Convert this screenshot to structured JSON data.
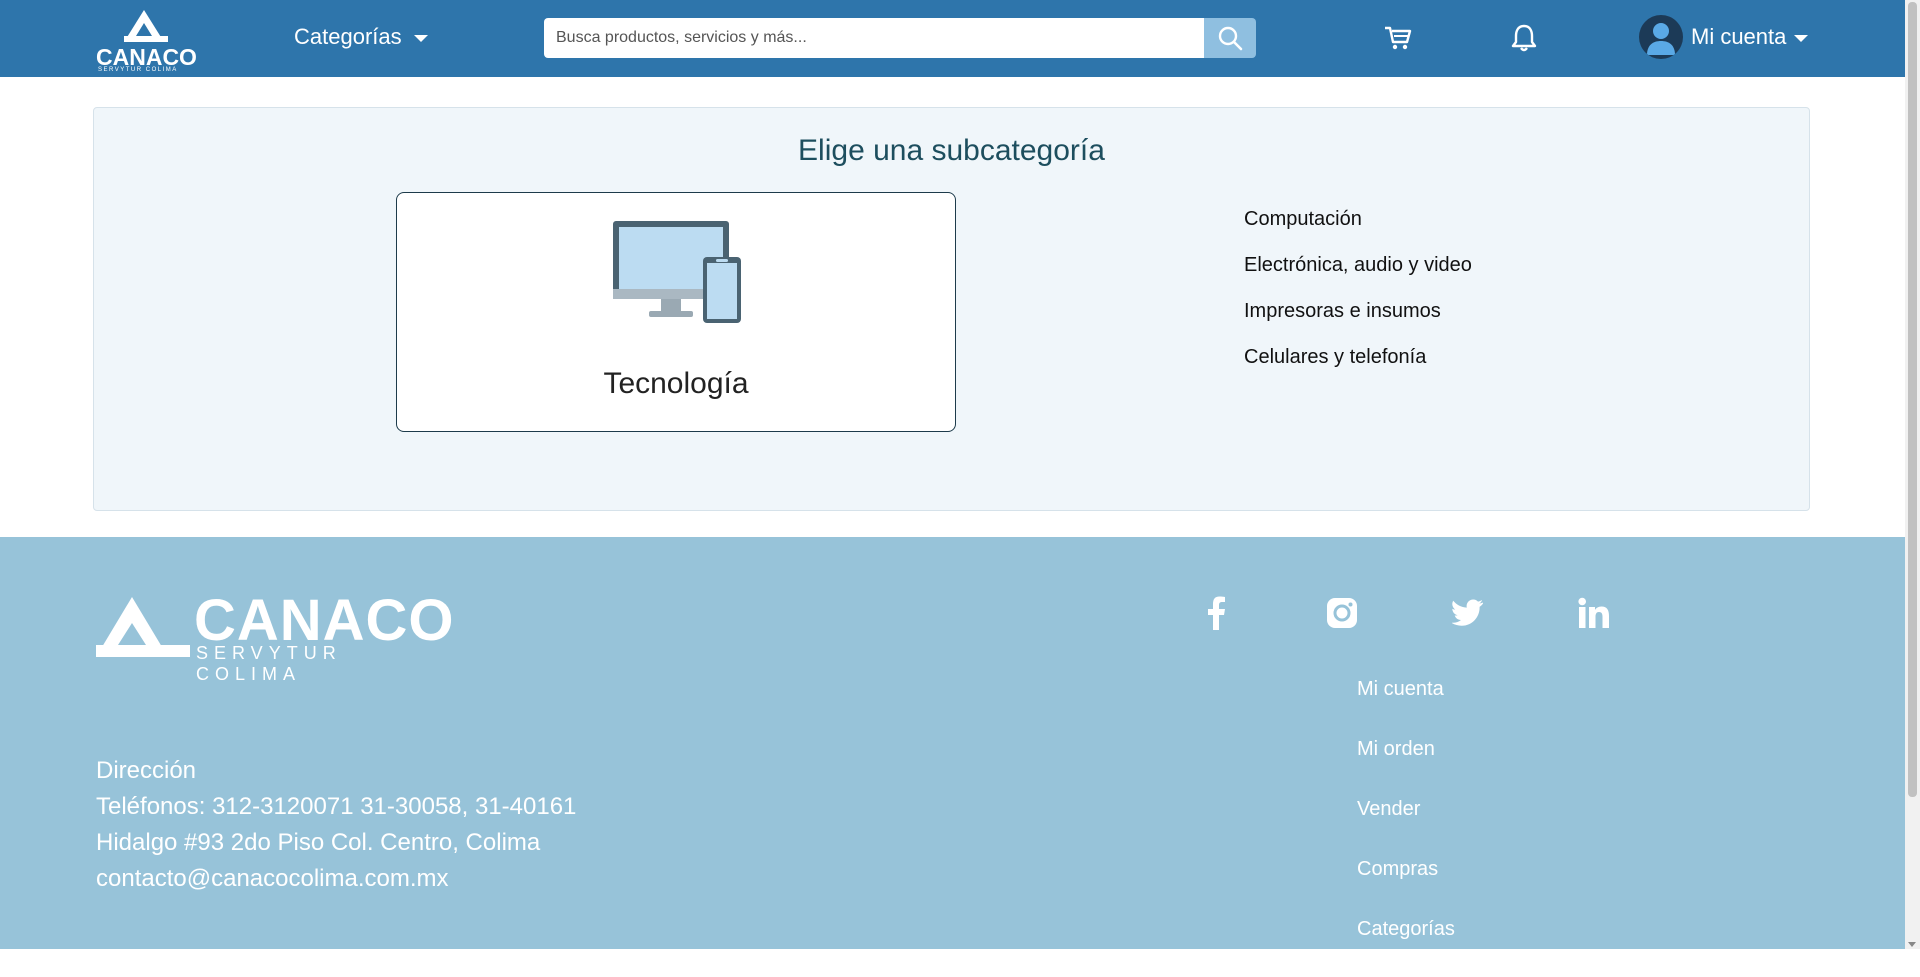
{
  "header": {
    "logo_text": "CANACO",
    "logo_subtext": "SERVYTUR COLIMA",
    "categories_label": "Categorías",
    "search_placeholder": "Busca productos, servicios y más...",
    "account_label": "Mi cuenta",
    "icons": [
      "search-icon",
      "cart-icon",
      "bell-icon",
      "user-icon",
      "chevron-down-icon"
    ]
  },
  "main": {
    "title": "Elige una subcategoría",
    "category": {
      "label": "Tecnología",
      "icon": "devices-icon"
    },
    "subcategories": [
      "Computación",
      "Electrónica, audio y video",
      "Impresoras e insumos",
      "Celulares y telefonía"
    ]
  },
  "footer": {
    "logo_text": "CANACO",
    "logo_subtext": "SERVYTUR COLIMA",
    "contact": {
      "heading": "Dirección",
      "phones": "Teléfonos: 312-3120071 31-30058, 31-40161",
      "address": "Hidalgo #93 2do Piso Col. Centro, Colima",
      "email": "contacto@canacocolima.com.mx"
    },
    "social": [
      "facebook-icon",
      "instagram-icon",
      "twitter-icon",
      "linkedin-icon"
    ],
    "links": [
      "Mi cuenta",
      "Mi orden",
      "Vender",
      "Compras",
      "Categorías"
    ]
  },
  "colors": {
    "header_bg": "#2e75ab",
    "footer_bg": "#97c3d9",
    "panel_bg": "#f0f6fa",
    "search_button": "#8fbfe0"
  }
}
